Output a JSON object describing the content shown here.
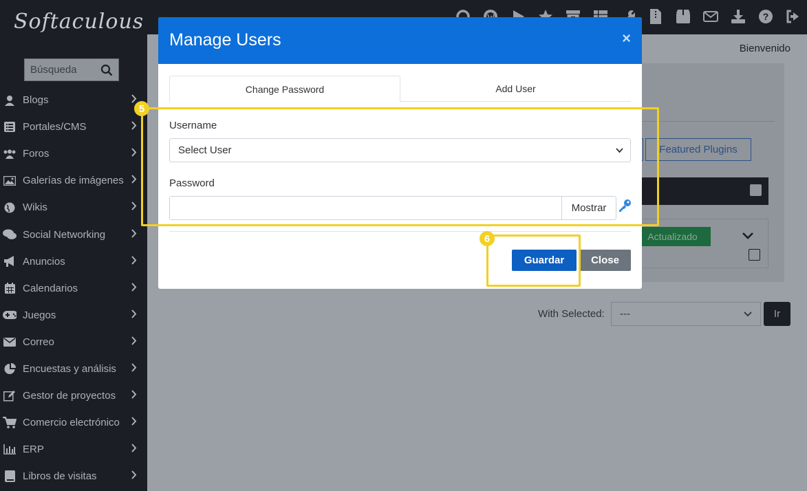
{
  "brand": {
    "logo_text": "Softaculous"
  },
  "sidebar": {
    "search_placeholder": "Búsqueda",
    "items": [
      {
        "label": "Blogs",
        "icon": "user-icon"
      },
      {
        "label": "Portales/CMS",
        "icon": "list-icon"
      },
      {
        "label": "Foros",
        "icon": "users-icon"
      },
      {
        "label": "Galerías de imágenes",
        "icon": "image-icon"
      },
      {
        "label": "Wikis",
        "icon": "globe-icon"
      },
      {
        "label": "Social Networking",
        "icon": "chat-icon"
      },
      {
        "label": "Anuncios",
        "icon": "megaphone-icon"
      },
      {
        "label": "Calendarios",
        "icon": "calendar-icon"
      },
      {
        "label": "Juegos",
        "icon": "gamepad-icon"
      },
      {
        "label": "Correo",
        "icon": "mail-icon"
      },
      {
        "label": "Encuestas y análisis",
        "icon": "pie-chart-icon"
      },
      {
        "label": "Gestor de proyectos",
        "icon": "edit-icon"
      },
      {
        "label": "Comercio electrónico",
        "icon": "cart-icon"
      },
      {
        "label": "ERP",
        "icon": "bar-chart-icon"
      },
      {
        "label": "Libros de visitas",
        "icon": "book-icon"
      }
    ]
  },
  "topbar": {
    "icons": [
      "cpanel-icon",
      "wordpress-icon",
      "play-icon",
      "star-icon",
      "archive-icon",
      "grid-icon",
      "wrench-icon",
      "file-icon",
      "box-icon",
      "mail-icon",
      "download-icon",
      "help-icon",
      "logout-icon"
    ],
    "welcome": "Bienvenido"
  },
  "background": {
    "featured_plugins_label": "Featured Plugins",
    "updated_label": "Actualizado",
    "with_selected_label": "With Selected:",
    "with_selected_value": "---",
    "go_label": "Ir"
  },
  "modal": {
    "title": "Manage Users",
    "close_symbol": "×",
    "tabs": [
      {
        "label": "Change Password",
        "active": true
      },
      {
        "label": "Add User",
        "active": false
      }
    ],
    "username_label": "Username",
    "username_value": "Select User",
    "password_label": "Password",
    "password_value": "",
    "show_label": "Mostrar",
    "save_label": "Guardar",
    "close_label": "Close"
  },
  "annotations": {
    "step5": "5",
    "step6": "6"
  },
  "colors": {
    "modal_header": "#0d6fd9",
    "primary_button": "#0d5fc2",
    "highlight": "#f2d024",
    "sidebar_bg": "#1b1f25"
  }
}
